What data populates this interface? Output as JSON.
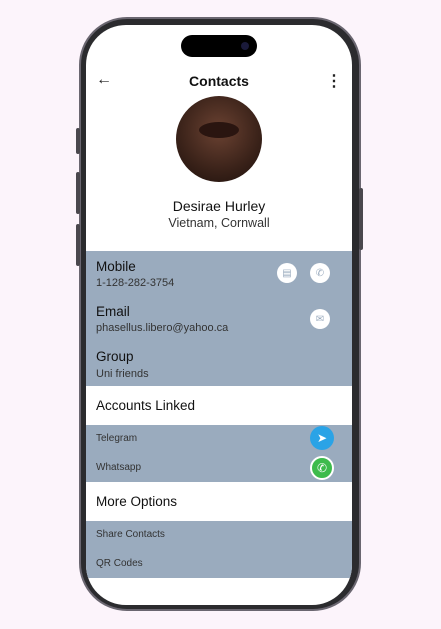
{
  "header": {
    "title": "Contacts",
    "back_icon": "arrow-left-icon",
    "menu_icon": "more-vert-icon"
  },
  "profile": {
    "name": "Desirae Hurley",
    "location": "Vietnam, Cornwall"
  },
  "details": {
    "mobile": {
      "label": "Mobile",
      "value": "1-128-282-3754"
    },
    "email": {
      "label": "Email",
      "value": "phasellus.libero@yahoo.ca"
    },
    "group": {
      "label": "Group",
      "value": "Uni friends"
    }
  },
  "accounts": {
    "title": "Accounts Linked",
    "items": [
      {
        "label": "Telegram",
        "color": "#2aa3e6"
      },
      {
        "label": "Whatsapp",
        "color": "#3dbb4c"
      }
    ]
  },
  "options": {
    "title": "More Options",
    "items": [
      {
        "label": "Share Contacts"
      },
      {
        "label": "QR Codes"
      }
    ]
  },
  "colors": {
    "section": "#9aabbe",
    "background": "#fcf4fb"
  }
}
